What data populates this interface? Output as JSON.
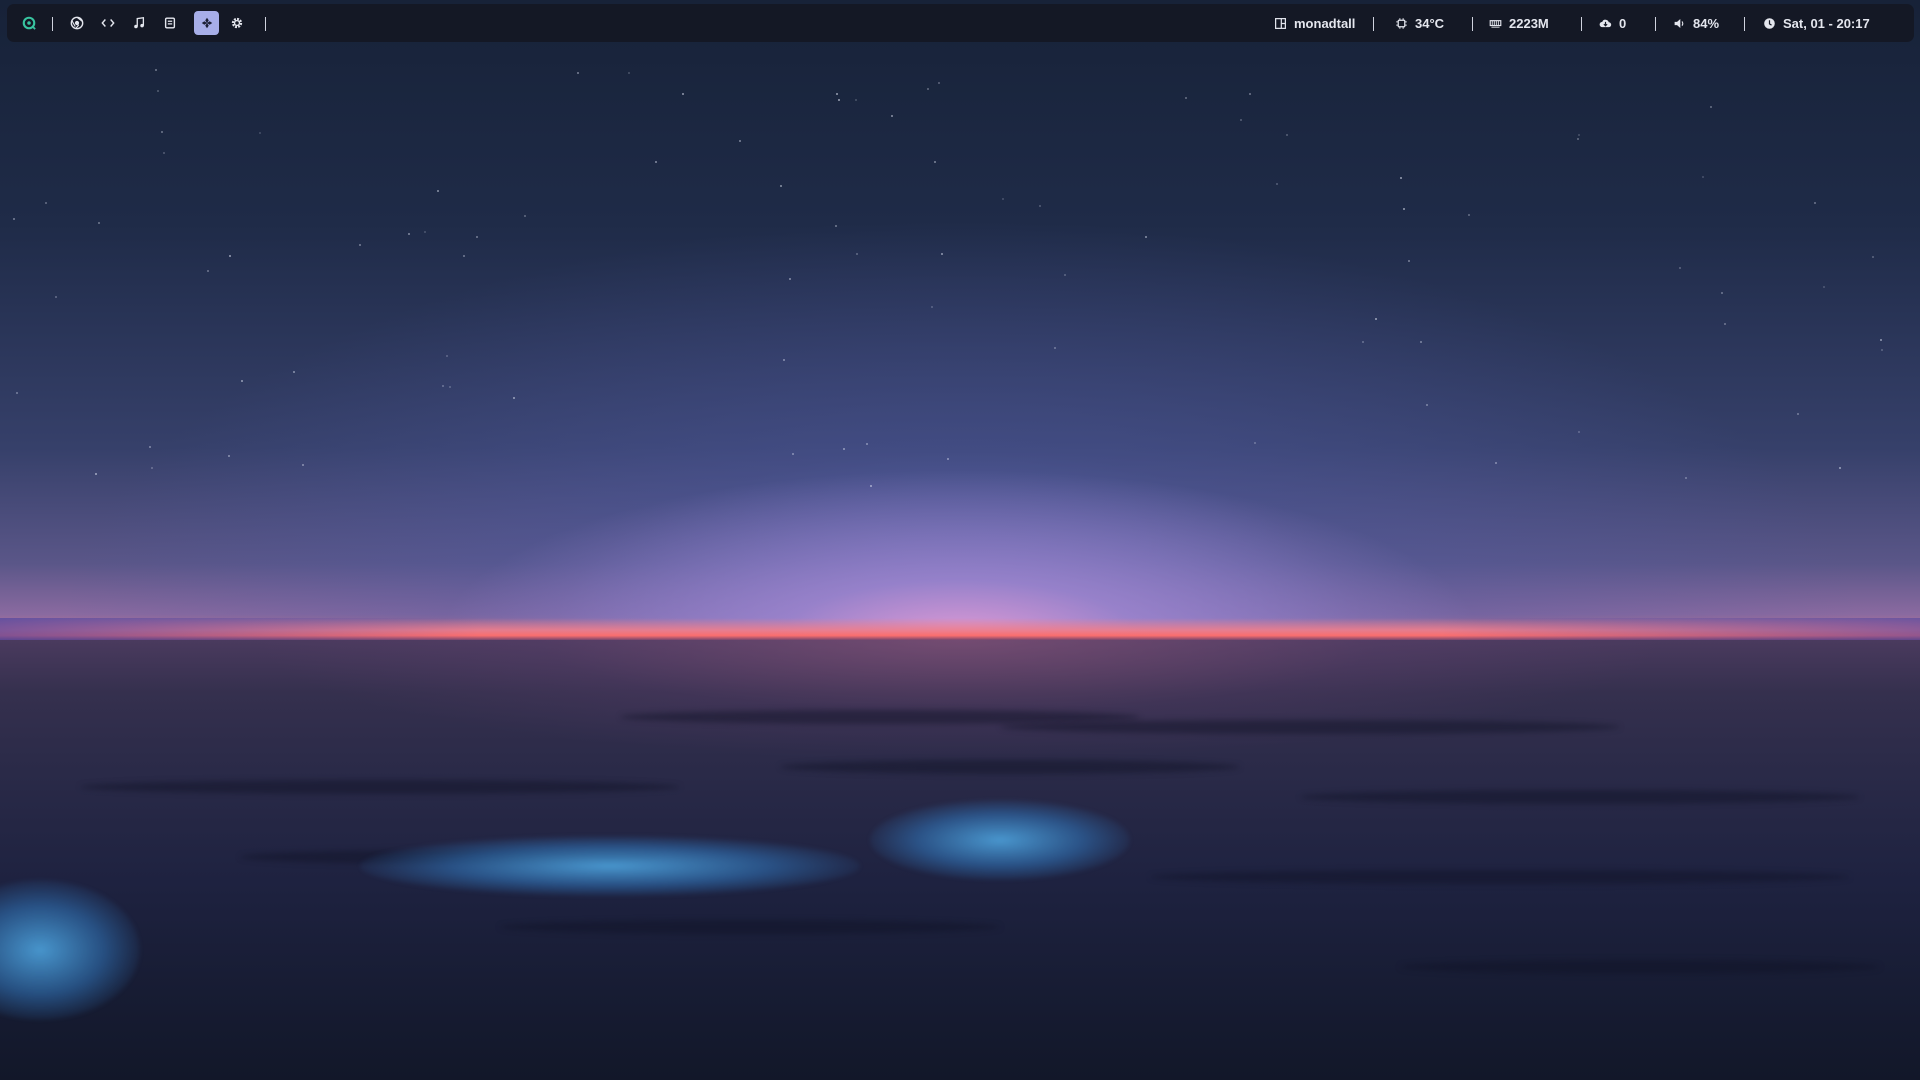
{
  "desktop": {
    "wallpaper": "ocean-horizon-dusk"
  },
  "topbar": {
    "launcher_icon": "arch-logo-icon",
    "accent": "#38c4a0",
    "active_workspace_color": "#a7aee8",
    "workspaces": [
      {
        "icon": "browser-icon",
        "active": false
      },
      {
        "icon": "code-icon",
        "active": false
      },
      {
        "icon": "music-icon",
        "active": false
      },
      {
        "icon": "files-icon",
        "active": false
      },
      {
        "icon": "gamepad-icon",
        "active": true
      },
      {
        "icon": "gear-icon",
        "active": false
      }
    ],
    "layout": {
      "icon": "layout-icon",
      "value": "monadtall"
    },
    "temperature": {
      "icon": "cpu-icon",
      "value": "34°C"
    },
    "memory": {
      "icon": "memory-icon",
      "value": "2223M"
    },
    "updates": {
      "icon": "cloud-download-icon",
      "value": "0"
    },
    "volume": {
      "icon": "volume-icon",
      "value": "84%"
    },
    "clock": {
      "icon": "clock-icon",
      "value": "Sat, 01 - 20:17"
    }
  }
}
